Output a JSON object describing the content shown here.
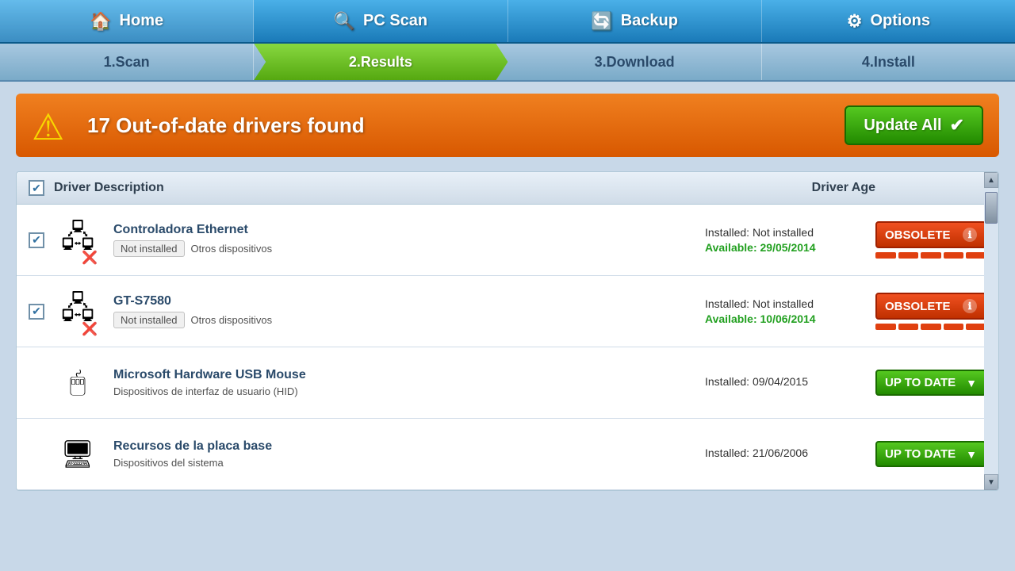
{
  "nav": {
    "items": [
      {
        "id": "home",
        "icon": "🏠",
        "label": "Home"
      },
      {
        "id": "pc-scan",
        "icon": "🔍",
        "label": "PC Scan"
      },
      {
        "id": "backup",
        "icon": "🔄",
        "label": "Backup"
      },
      {
        "id": "options",
        "icon": "⚙",
        "label": "Options"
      }
    ]
  },
  "steps": [
    {
      "id": "scan",
      "label": "1.Scan",
      "active": false
    },
    {
      "id": "results",
      "label": "2.Results",
      "active": true
    },
    {
      "id": "download",
      "label": "3.Download",
      "active": false
    },
    {
      "id": "install",
      "label": "4.Install",
      "active": false
    }
  ],
  "alert": {
    "icon": "⚠",
    "message": "17 Out-of-date drivers found",
    "button_label": "Update All",
    "button_icon": "✔"
  },
  "table": {
    "header": {
      "checkbox_checked": "✔",
      "desc_label": "Driver Description",
      "age_label": "Driver Age"
    },
    "drivers": [
      {
        "id": "ethernet",
        "checked": true,
        "icon": "💻",
        "error_icon": "❌",
        "name": "Controladora Ethernet",
        "tag_status": "Not installed",
        "tag_category": "Otros dispositivos",
        "installed_label": "Installed:",
        "installed_value": "Not installed",
        "available_label": "Available:",
        "available_value": "29/05/2014",
        "status": "OBSOLETE",
        "status_type": "obsolete"
      },
      {
        "id": "gt-s7580",
        "checked": true,
        "icon": "💻",
        "error_icon": "❌",
        "name": "GT-S7580",
        "tag_status": "Not installed",
        "tag_category": "Otros dispositivos",
        "installed_label": "Installed:",
        "installed_value": "Not installed",
        "available_label": "Available:",
        "available_value": "10/06/2014",
        "status": "OBSOLETE",
        "status_type": "obsolete"
      },
      {
        "id": "usb-mouse",
        "checked": false,
        "icon": "🖱",
        "error_icon": "",
        "name": "Microsoft Hardware USB Mouse",
        "tag_status": "",
        "tag_category": "Dispositivos de interfaz de usuario (HID)",
        "installed_label": "Installed:",
        "installed_value": "09/04/2015",
        "available_label": "",
        "available_value": "",
        "status": "UP TO DATE",
        "status_type": "uptodate"
      },
      {
        "id": "motherboard",
        "checked": false,
        "icon": "🖥",
        "error_icon": "",
        "name": "Recursos de la placa base",
        "tag_status": "",
        "tag_category": "Dispositivos del sistema",
        "installed_label": "Installed:",
        "installed_value": "21/06/2006",
        "available_label": "",
        "available_value": "",
        "status": "UP TO DATE",
        "status_type": "uptodate"
      }
    ]
  }
}
